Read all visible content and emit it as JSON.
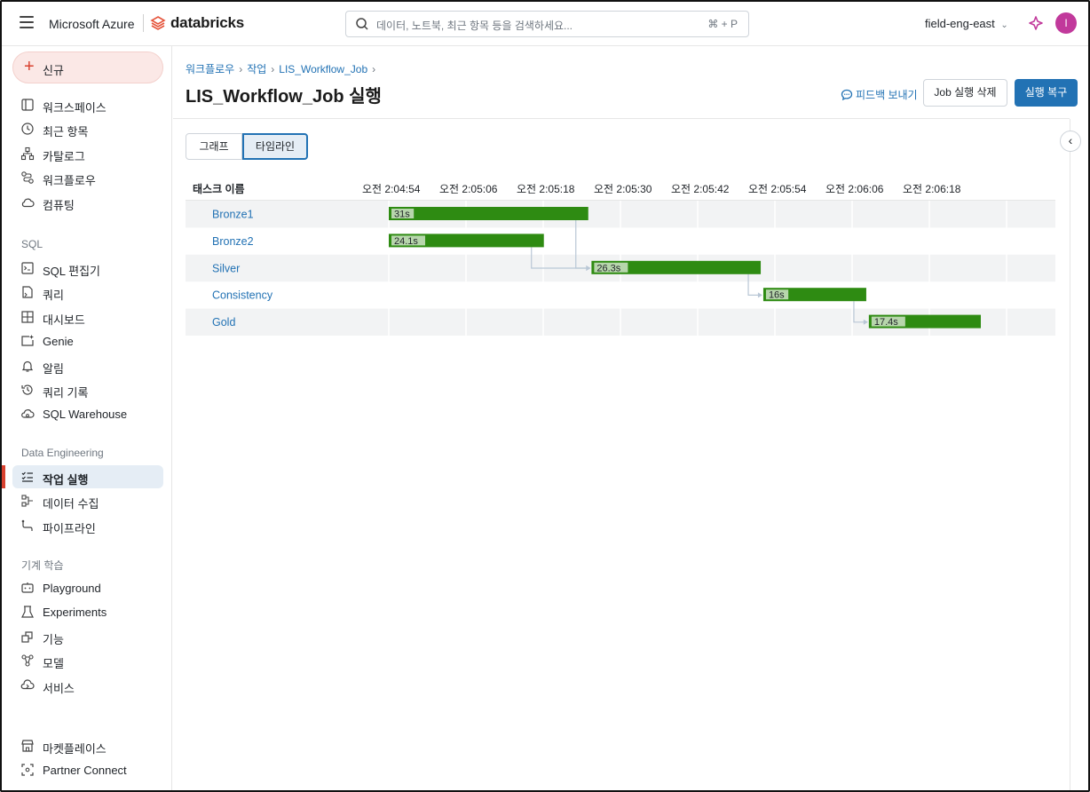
{
  "topbar": {
    "ms_brand": "Microsoft Azure",
    "db_brand": "databricks",
    "search_placeholder": "데이터, 노트북, 최근 항목 등을 검색하세요...",
    "search_shortcut": "⌘ + P",
    "workspace": "field-eng-east",
    "avatar_initial": "I"
  },
  "sidebar": {
    "new_label": "신규",
    "top_items": [
      {
        "label": "워크스페이스",
        "icon": "workspace-icon"
      },
      {
        "label": "최근 항목",
        "icon": "clock-icon"
      },
      {
        "label": "카탈로그",
        "icon": "catalog-icon"
      },
      {
        "label": "워크플로우",
        "icon": "workflows-icon"
      },
      {
        "label": "컴퓨팅",
        "icon": "cloud-icon"
      }
    ],
    "sql_section": "SQL",
    "sql_items": [
      {
        "label": "SQL 편집기",
        "icon": "sql-editor-icon"
      },
      {
        "label": "쿼리",
        "icon": "query-icon"
      },
      {
        "label": "대시보드",
        "icon": "dashboard-icon"
      },
      {
        "label": "Genie",
        "icon": "genie-icon"
      },
      {
        "label": "알림",
        "icon": "bell-icon"
      },
      {
        "label": "쿼리 기록",
        "icon": "history-icon"
      },
      {
        "label": "SQL Warehouse",
        "icon": "warehouse-icon"
      }
    ],
    "de_section": "Data Engineering",
    "de_items": [
      {
        "label": "작업 실행",
        "icon": "job-runs-icon",
        "active": true
      },
      {
        "label": "데이터 수집",
        "icon": "ingest-icon"
      },
      {
        "label": "파이프라인",
        "icon": "pipeline-icon"
      }
    ],
    "ml_section": "기계 학습",
    "ml_items": [
      {
        "label": "Playground",
        "icon": "playground-icon"
      },
      {
        "label": "Experiments",
        "icon": "beaker-icon"
      },
      {
        "label": "기능",
        "icon": "features-icon"
      },
      {
        "label": "모델",
        "icon": "models-icon"
      },
      {
        "label": "서비스",
        "icon": "serving-icon"
      }
    ],
    "bottom_items": [
      {
        "label": "마켓플레이스",
        "icon": "store-icon"
      },
      {
        "label": "Partner Connect",
        "icon": "partner-icon"
      }
    ]
  },
  "header": {
    "breadcrumb": [
      "워크플로우",
      "작업",
      "LIS_Workflow_Job"
    ],
    "title": "LIS_Workflow_Job 실행",
    "feedback": "피드백 보내기",
    "delete_button": "Job 실행 삭제",
    "repair_button": "실행 복구"
  },
  "view_toggle": {
    "graph": "그래프",
    "timeline": "타임라인",
    "selected": "timeline"
  },
  "timeline": {
    "name_header": "태스크 이름",
    "ticks": [
      "오전 2:04:54",
      "오전 2:05:06",
      "오전 2:05:18",
      "오전 2:05:30",
      "오전 2:05:42",
      "오전 2:05:54",
      "오전 2:06:06",
      "오전 2:06:18"
    ],
    "tick_seconds": 12,
    "axis_start_seconds": 0,
    "tasks": [
      {
        "name": "Bronze1",
        "start": 0.0,
        "duration": 31,
        "label": "31s",
        "depends_on": null
      },
      {
        "name": "Bronze2",
        "start": 0.0,
        "duration": 24.1,
        "label": "24.1s",
        "depends_on": null
      },
      {
        "name": "Silver",
        "start": 31.5,
        "duration": 26.3,
        "label": "26.3s",
        "depends_on": [
          "Bronze1",
          "Bronze2"
        ]
      },
      {
        "name": "Consistency",
        "start": 58.2,
        "duration": 16,
        "label": "16s",
        "depends_on": [
          "Silver"
        ]
      },
      {
        "name": "Gold",
        "start": 74.6,
        "duration": 17.4,
        "label": "17.4s",
        "depends_on": [
          "Consistency"
        ]
      }
    ],
    "bar_color": "#2e8b12",
    "link_color": "#b9c7d6",
    "stripe_color": "#f2f3f4"
  }
}
